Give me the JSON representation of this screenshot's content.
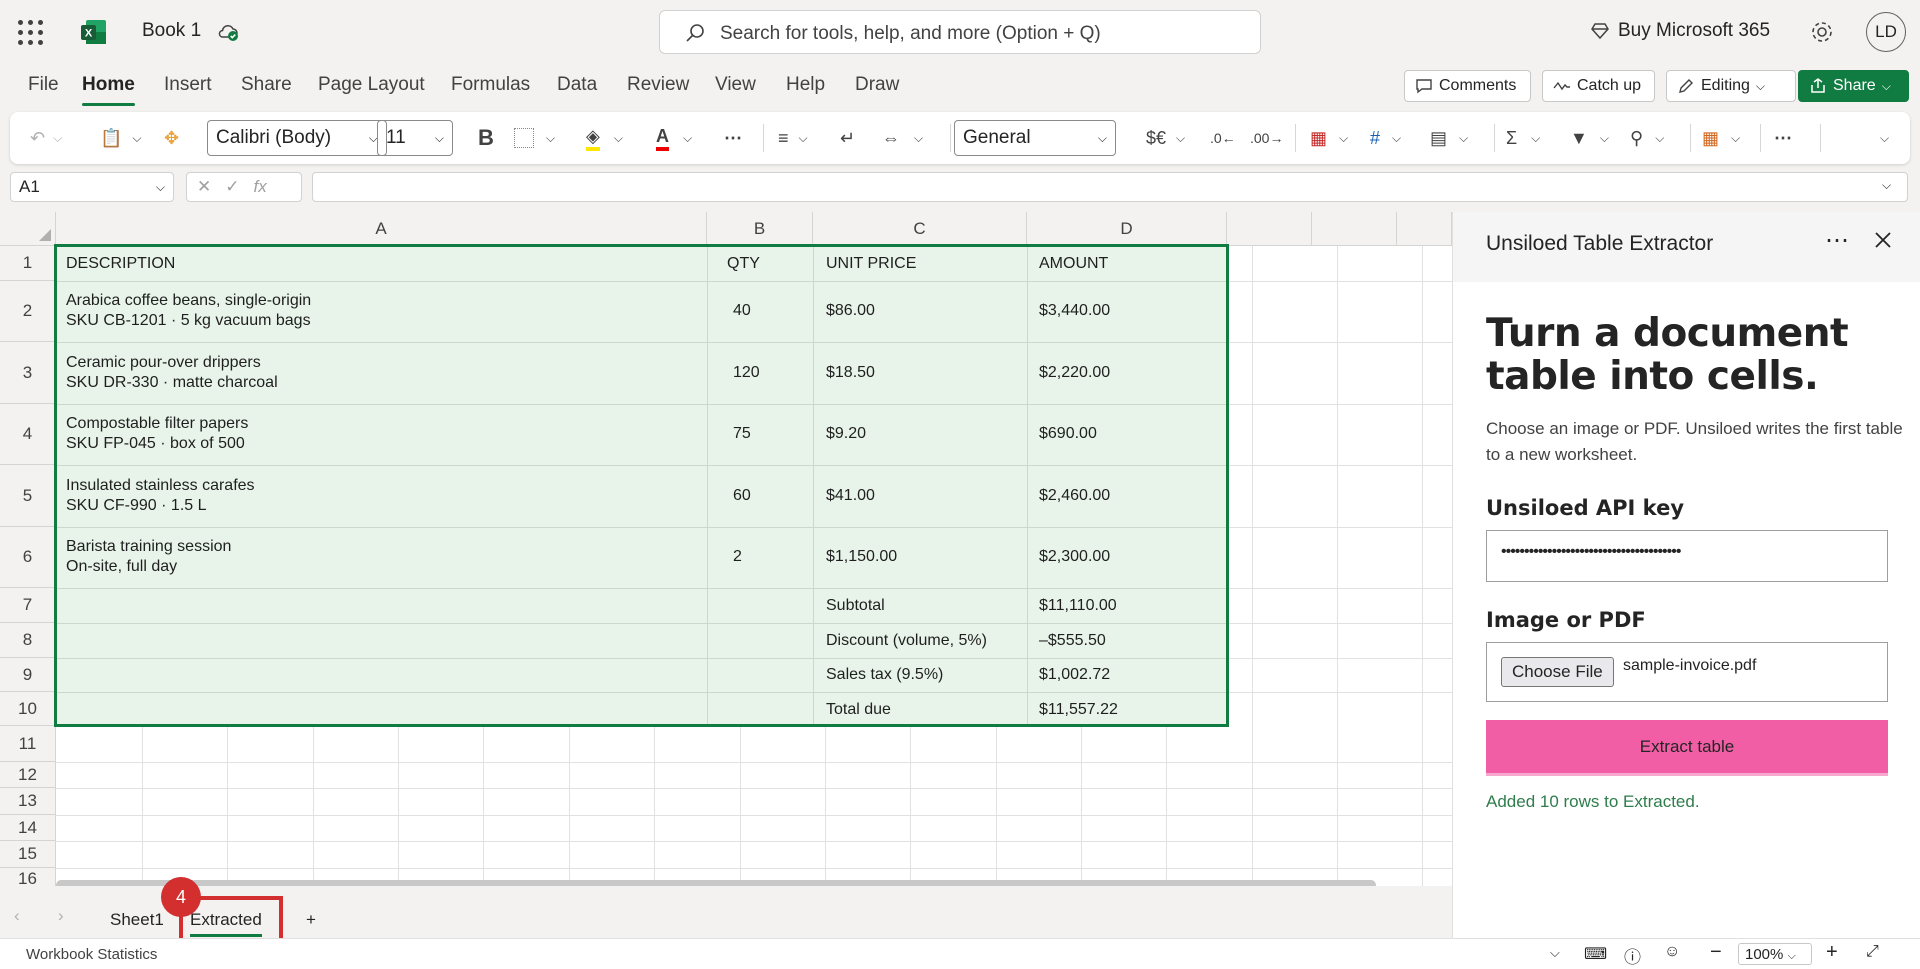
{
  "app": {
    "book_title": "Book 1",
    "search_placeholder": "Search for tools, help, and more (Option + Q)",
    "buy_label": "Buy Microsoft 365",
    "avatar_initials": "LD"
  },
  "menu": [
    "File",
    "Home",
    "Insert",
    "Share",
    "Page Layout",
    "Formulas",
    "Data",
    "Review",
    "View",
    "Help",
    "Draw"
  ],
  "menu_active": "Home",
  "actions": {
    "comments": "Comments",
    "catch_up": "Catch up",
    "editing": "Editing",
    "share": "Share"
  },
  "ribbon": {
    "font_name": "Calibri (Body)",
    "font_size": "11",
    "number_format": "General",
    "bold": "B",
    "currency": "$€"
  },
  "formula_bar": {
    "name_box": "A1",
    "fx": "fx",
    "value": ""
  },
  "columns": [
    "A",
    "B",
    "C",
    "D"
  ],
  "rows": [
    "1",
    "2",
    "3",
    "4",
    "5",
    "6",
    "7",
    "8",
    "9",
    "10",
    "11",
    "12",
    "13",
    "14",
    "15",
    "16"
  ],
  "table": [
    {
      "a": "DESCRIPTION",
      "b": "QTY",
      "c": "UNIT PRICE",
      "d": "AMOUNT"
    },
    {
      "a": "Arabica coffee beans, single-origin\nSKU CB-1201 · 5 kg vacuum bags",
      "b": "40",
      "c": "$86.00",
      "d": "$3,440.00"
    },
    {
      "a": "Ceramic pour-over drippers\nSKU DR-330 · matte charcoal",
      "b": "120",
      "c": "$18.50",
      "d": "$2,220.00"
    },
    {
      "a": "Compostable filter papers\nSKU FP-045 · box of 500",
      "b": "75",
      "c": "$9.20",
      "d": "$690.00"
    },
    {
      "a": "Insulated stainless carafes\nSKU CF-990 · 1.5 L",
      "b": "60",
      "c": "$41.00",
      "d": "$2,460.00"
    },
    {
      "a": "Barista training session\nOn-site, full day",
      "b": "2",
      "c": "$1,150.00",
      "d": "$2,300.00"
    },
    {
      "a": "",
      "b": "",
      "c": "Subtotal",
      "d": "$11,110.00"
    },
    {
      "a": "",
      "b": "",
      "c": "Discount (volume, 5%)",
      "d": "–$555.50"
    },
    {
      "a": "",
      "b": "",
      "c": "Sales tax (9.5%)",
      "d": "$1,002.72"
    },
    {
      "a": "",
      "b": "",
      "c": "Total due",
      "d": "$11,557.22"
    }
  ],
  "sheets": {
    "tabs": [
      "Sheet1",
      "Extracted"
    ],
    "active": "Extracted",
    "add": "+",
    "badge": "4"
  },
  "status": {
    "left": "Workbook Statistics",
    "zoom": "100%"
  },
  "pane": {
    "title": "Unsiloed Table Extractor",
    "heading": "Turn a document table into cells.",
    "description": "Choose an image or PDF. Unsiloed writes the first table to a new worksheet.",
    "api_key_label": "Unsiloed API key",
    "api_key_value": "•••••••••••••••••••••••••••••••••••••••",
    "file_label": "Image or PDF",
    "choose_file": "Choose File",
    "file_name": "sample-invoice.pdf",
    "extract_button": "Extract table",
    "status_message": "Added 10 rows to Extracted."
  },
  "colors": {
    "accent": "#107c41",
    "selection_fill": "#e8f4ea",
    "extract_button": "#f25ea6",
    "badge": "#d32f2f",
    "status_text": "#2e7d4b"
  }
}
